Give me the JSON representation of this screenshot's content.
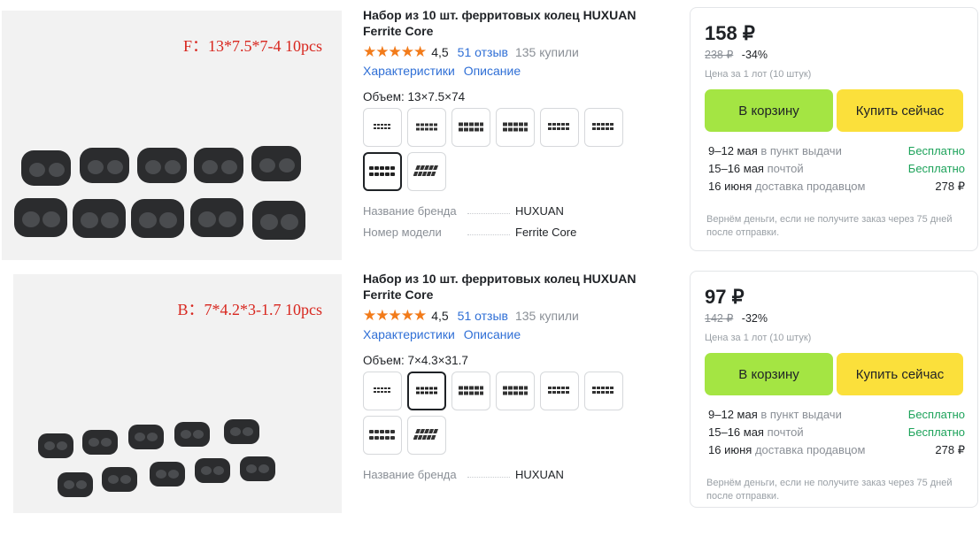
{
  "products": [
    {
      "photo_label": "F：13*7.5*7-4 10pcs",
      "title": "Набор из 10 шт. ферритовых колец HUXUAN Ferrite Core",
      "stars": "★★★★★",
      "rating": "4,5",
      "reviews": "51 отзыв",
      "sold": "135 купили",
      "links": [
        "Характеристики",
        "Описание"
      ],
      "volume_label": "Объем: 13×7.5×74",
      "selected_option": 7,
      "attributes": [
        {
          "key": "Название бренда",
          "value": "HUXUAN"
        },
        {
          "key": "Номер модели",
          "value": "Ferrite Core"
        }
      ],
      "price": "158 ₽",
      "old_price": "238 ₽",
      "discount": "-34%",
      "unit_note": "Цена за 1 лот (10 штук)",
      "cart_button": "В корзину",
      "buy_now_button": "Купить сейчас",
      "delivery": [
        {
          "date": "9–12 мая",
          "method": "в пункт выдачи",
          "price": "Бесплатно"
        },
        {
          "date": "15–16 мая",
          "method": "почтой",
          "price": "Бесплатно"
        },
        {
          "date": "16 июня",
          "method": "доставка продавцом",
          "price": "278 ₽"
        }
      ],
      "refund_note": "Вернём деньги, если не получите заказ через 75 дней после отправки."
    },
    {
      "photo_label": "B：7*4.2*3-1.7 10pcs",
      "title": "Набор из 10 шт. ферритовых колец HUXUAN Ferrite Core",
      "stars": "★★★★★",
      "rating": "4,5",
      "reviews": "51 отзыв",
      "sold": "135 купили",
      "links": [
        "Характеристики",
        "Описание"
      ],
      "volume_label": "Объем: 7×4.3×31.7",
      "selected_option": 2,
      "attributes": [
        {
          "key": "Название бренда",
          "value": "HUXUAN"
        }
      ],
      "price": "97 ₽",
      "old_price": "142 ₽",
      "discount": "-32%",
      "unit_note": "Цена за 1 лот (10 штук)",
      "cart_button": "В корзину",
      "buy_now_button": "Купить сейчас",
      "delivery": [
        {
          "date": "9–12 мая",
          "method": "в пункт выдачи",
          "price": "Бесплатно"
        },
        {
          "date": "15–16 мая",
          "method": "почтой",
          "price": "Бесплатно"
        },
        {
          "date": "16 июня",
          "method": "доставка продавцом",
          "price": "278 ₽"
        }
      ],
      "refund_note": "Вернём деньги, если не получите заказ через 75 дней после отправки."
    }
  ],
  "colors": {
    "link": "#2f6fd6",
    "star": "#f27b1a",
    "cart_button": "#a4e543",
    "buy_now_button": "#fbe03b",
    "free_delivery": "#1ea35b",
    "photo_label": "#d8271f"
  }
}
